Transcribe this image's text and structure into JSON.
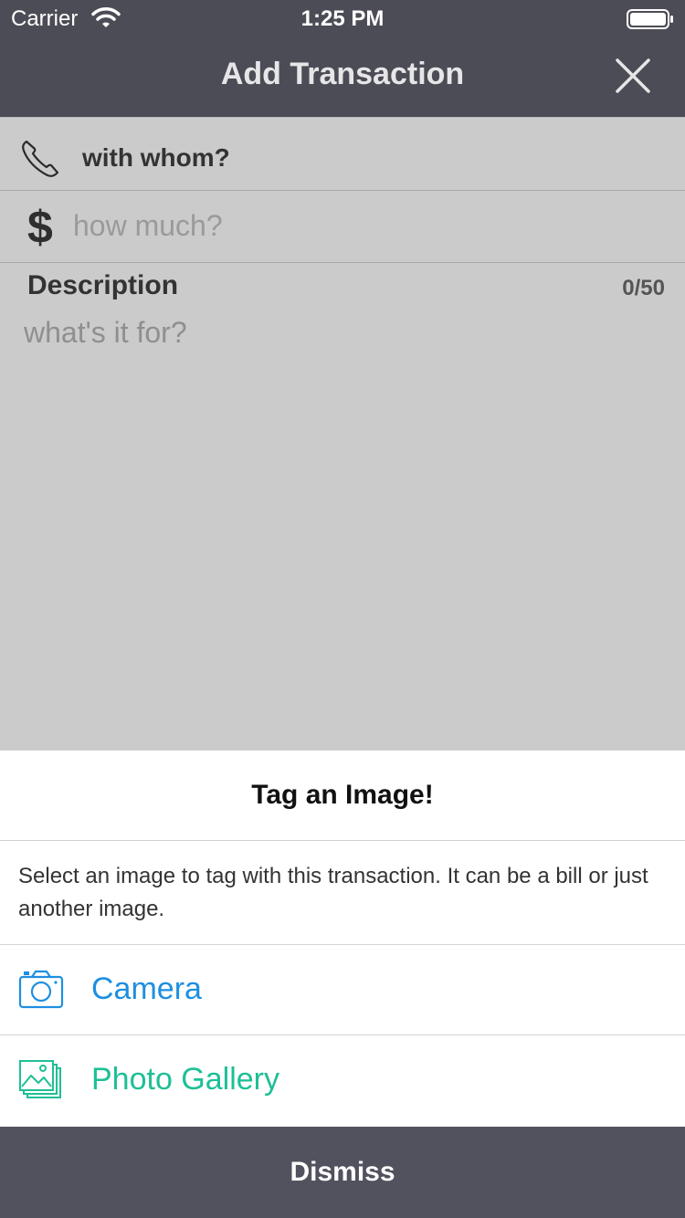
{
  "status_bar": {
    "carrier": "Carrier",
    "time": "1:25 PM"
  },
  "header": {
    "title": "Add Transaction"
  },
  "form": {
    "with_whom": "with whom?",
    "currency_symbol": "$",
    "amount_placeholder": "how much?",
    "description_label": "Description",
    "description_counter": "0/50",
    "description_placeholder": "what's it for?"
  },
  "sheet": {
    "title": "Tag an Image!",
    "message": "Select an image to tag with this transaction. It can be a bill or just another image.",
    "options": [
      {
        "label": "Camera",
        "icon": "camera-icon",
        "color": "#1e8fe0"
      },
      {
        "label": "Photo Gallery",
        "icon": "photo-gallery-icon",
        "color": "#1ebf96"
      }
    ],
    "dismiss_label": "Dismiss"
  },
  "colors": {
    "header_bg": "#4c4c56",
    "dimmed_bg": "#cbcbcb",
    "dismiss_bg": "#52525f"
  }
}
